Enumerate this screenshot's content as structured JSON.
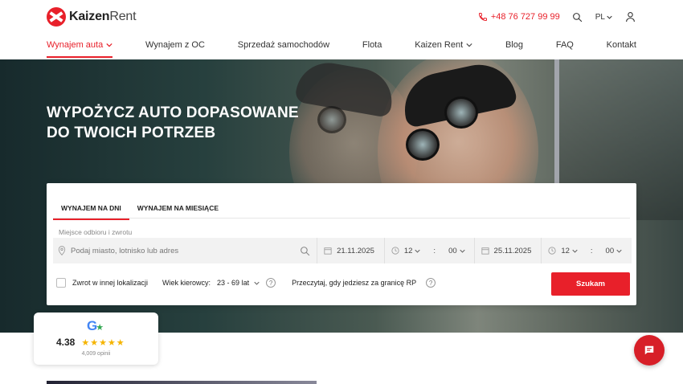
{
  "brand": {
    "name_bold": "Kaizen",
    "name_light": "Rent"
  },
  "topbar": {
    "phone": "+48 76 727 99 99",
    "language": "PL"
  },
  "nav": [
    {
      "label": "Wynajem auta",
      "active": true,
      "dropdown": true
    },
    {
      "label": "Wynajem z OC"
    },
    {
      "label": "Sprzedaż samochodów"
    },
    {
      "label": "Flota"
    },
    {
      "label": "Kaizen Rent",
      "dropdown": true
    },
    {
      "label": "Blog"
    },
    {
      "label": "FAQ"
    },
    {
      "label": "Kontakt"
    }
  ],
  "hero": {
    "title_line1": "WYPOŻYCZ AUTO DOPASOWANE",
    "title_line2": "DO TWOICH POTRZEB"
  },
  "booking": {
    "tabs": [
      "WYNAJEM NA DNI",
      "WYNAJEM NA MIESIĄCE"
    ],
    "location_label": "Miejsce odbioru i zwrotu",
    "location_placeholder": "Podaj miasto, lotnisko lub adres",
    "pickup_date": "21.11.2025",
    "pickup_hour": "12",
    "pickup_minute": "00",
    "return_date": "25.11.2025",
    "return_hour": "12",
    "return_minute": "00",
    "return_elsewhere": "Zwrot w innej lokalizacji",
    "age_label": "Wiek kierowcy:",
    "age_value": "23 - 69 lat",
    "border_text": "Przeczytaj, gdy jedziesz za granicę RP",
    "search_button": "Szukam"
  },
  "rating": {
    "score": "4.38",
    "reviews": "4,009 opinii",
    "stars": "★★★★★"
  },
  "colors": {
    "accent": "#e8202a"
  }
}
